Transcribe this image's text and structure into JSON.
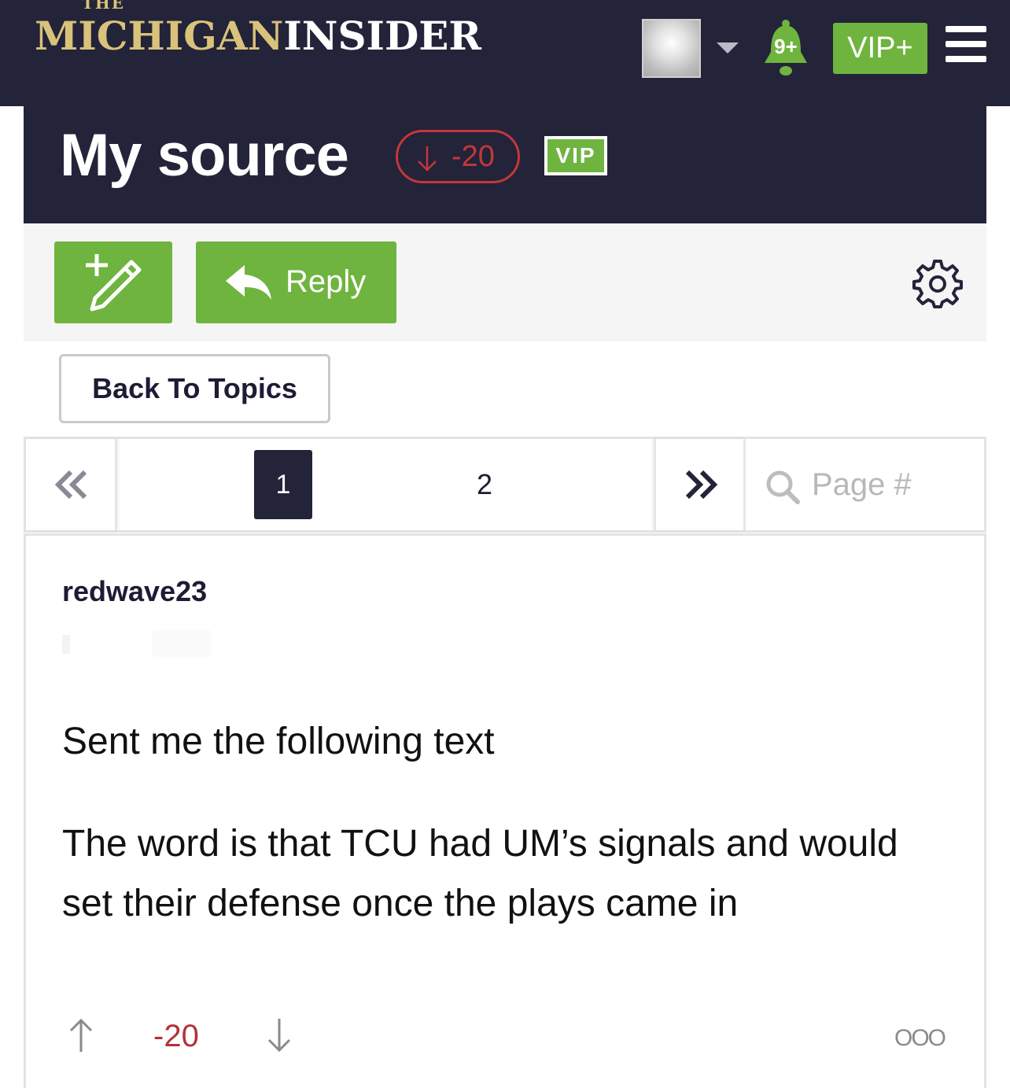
{
  "header": {
    "logo_the": "THE",
    "logo_michigan": "MICHIGAN",
    "logo_insider": "INSIDER",
    "notification_count": "9+",
    "vip_plus_label": "VIP+",
    "icons": [
      "avatar",
      "caret-down-icon",
      "bell-icon",
      "hamburger-menu-icon"
    ]
  },
  "topic": {
    "title": "My source",
    "score": "-20",
    "badge": "VIP"
  },
  "toolbar": {
    "reply_label": "Reply",
    "icons": [
      "new-topic-icon",
      "reply-arrow-icon",
      "gear-icon"
    ]
  },
  "back_label": "Back To Topics",
  "pagination": {
    "pages": [
      "1",
      "2"
    ],
    "current_page": "1",
    "search_placeholder": "Page #",
    "icons": [
      "double-chevron-left-icon",
      "double-chevron-right-icon",
      "search-icon"
    ]
  },
  "post": {
    "author": "redwave23",
    "paragraphs": [
      "Sent me the following text",
      "The word is that TCU had UM’s signals and would set their defense once the plays came in"
    ],
    "vote_count": "-20",
    "more_label": "OOO"
  },
  "colors": {
    "navy": "#232339",
    "green": "#6fb43f",
    "gold": "#d9c27a",
    "negative_red": "#c3373a"
  }
}
